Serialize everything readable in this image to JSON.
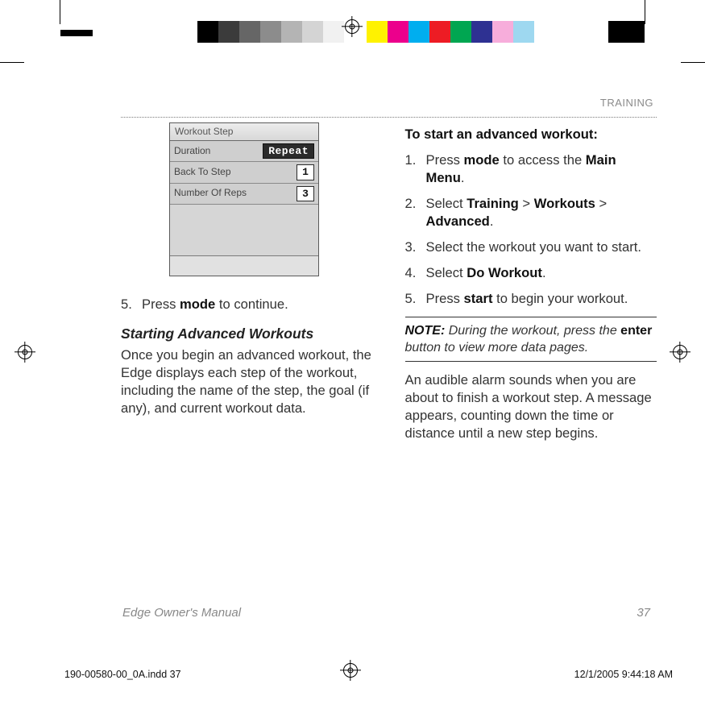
{
  "section_label": "TRAINING",
  "device": {
    "title": "Workout Step",
    "row1_label": "Duration",
    "row1_value": "Repeat",
    "row2_label": "Back To Step",
    "row2_value": "1",
    "row3_label": "Number Of Reps",
    "row3_value": "3"
  },
  "left": {
    "continue_step": "Press mode to continue.",
    "heading": "Starting Advanced Workouts",
    "body": "Once you begin an advanced workout, the Edge displays each step of the workout, including the name of the step, the goal (if any), and current workout data."
  },
  "right": {
    "heading": "To start an advanced workout:",
    "s1a": "Press ",
    "s1b": "mode",
    "s1c": " to access the ",
    "s1d": "Main Menu",
    "s1e": ".",
    "s2a": "Select ",
    "s2b": "Training",
    "s2c": " > ",
    "s2d": "Workouts",
    "s2e": " > ",
    "s2f": "Advanced",
    "s2g": ".",
    "s3": "Select the workout you want to start.",
    "s4a": "Select ",
    "s4b": "Do Workout",
    "s4c": ".",
    "s5a": "Press ",
    "s5b": "start",
    "s5c": " to begin your workout.",
    "note_label": "NOTE:",
    "note_a": " During the workout, press the ",
    "note_b": "enter",
    "note_c": " button to view more data pages.",
    "after": "An audible alarm sounds when you are about to finish a workout step. A message appears, counting down the time or distance until a new step begins."
  },
  "footer_left": "Edge Owner's Manual",
  "footer_right": "37",
  "slug_left": "190-00580-00_0A.indd   37",
  "slug_right": "12/1/2005   9:44:18 AM",
  "colors": {
    "greys": [
      "#000000",
      "#3b3b3b",
      "#666666",
      "#8c8c8c",
      "#b4b4b4",
      "#d4d4d4",
      "#f1f1f1"
    ],
    "swatches": [
      "#fff200",
      "#ec008c",
      "#00aeef",
      "#ed1c24",
      "#00a651",
      "#2e3192",
      "#F7ADDB",
      "#9ED8F0"
    ]
  }
}
